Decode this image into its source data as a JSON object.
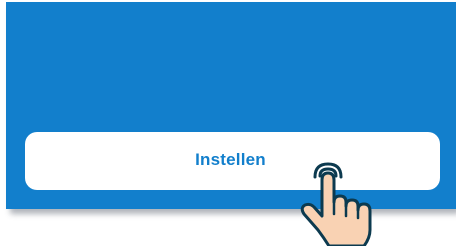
{
  "screen": {
    "background_color": "#127fcc"
  },
  "cta_button": {
    "label": "Instellen",
    "label_color": "#127fcc",
    "background_color": "#ffffff"
  },
  "tap_indicator": {
    "icon": "hand-pointer-tap-icon",
    "fill_color": "#f9d2b3",
    "stroke_color": "#0c3a4f"
  }
}
